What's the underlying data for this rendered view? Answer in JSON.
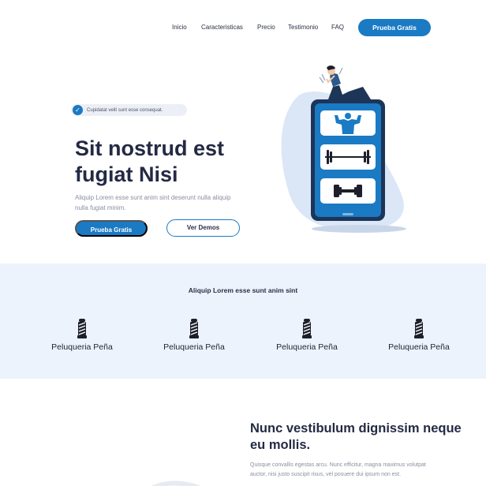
{
  "nav": {
    "links": [
      "Inicio",
      "Caracteristicas",
      "Precio",
      "Testimonio",
      "FAQ"
    ],
    "cta": "Prueba Gratis"
  },
  "hero": {
    "badge": "Cupidatat velit sunt esse consequat.",
    "title": "Sit nostrud est fugiat Nisi",
    "subtitle": "Aliquip Lorem esse sunt anim sint deserunt nulla aliquip nulla fugiat minim.",
    "primary_button": "Prueba Gratis",
    "secondary_button": "Ver Demos"
  },
  "partners": {
    "title": "Aliquip Lorem esse sunt anim sint",
    "logos": [
      "Peluqueria Peña",
      "Peluqueria Peña",
      "Peluqueria Peña",
      "Peluqueria Peña"
    ]
  },
  "feature": {
    "title": "Nunc vestibulum dignissim neque eu mollis.",
    "body": "Quisque convallis egestas arcu. Nunc efficitur, magna maximus volutpat auctor, nisi justo suscipit risus, vel posuere dui ipsum non est."
  },
  "colors": {
    "accent": "#1a7ac4",
    "heading": "#242a44",
    "strip_bg": "#edf3fc"
  },
  "icons": [
    "check-icon",
    "phone-fitness-illustration",
    "barber-pole-icon"
  ]
}
